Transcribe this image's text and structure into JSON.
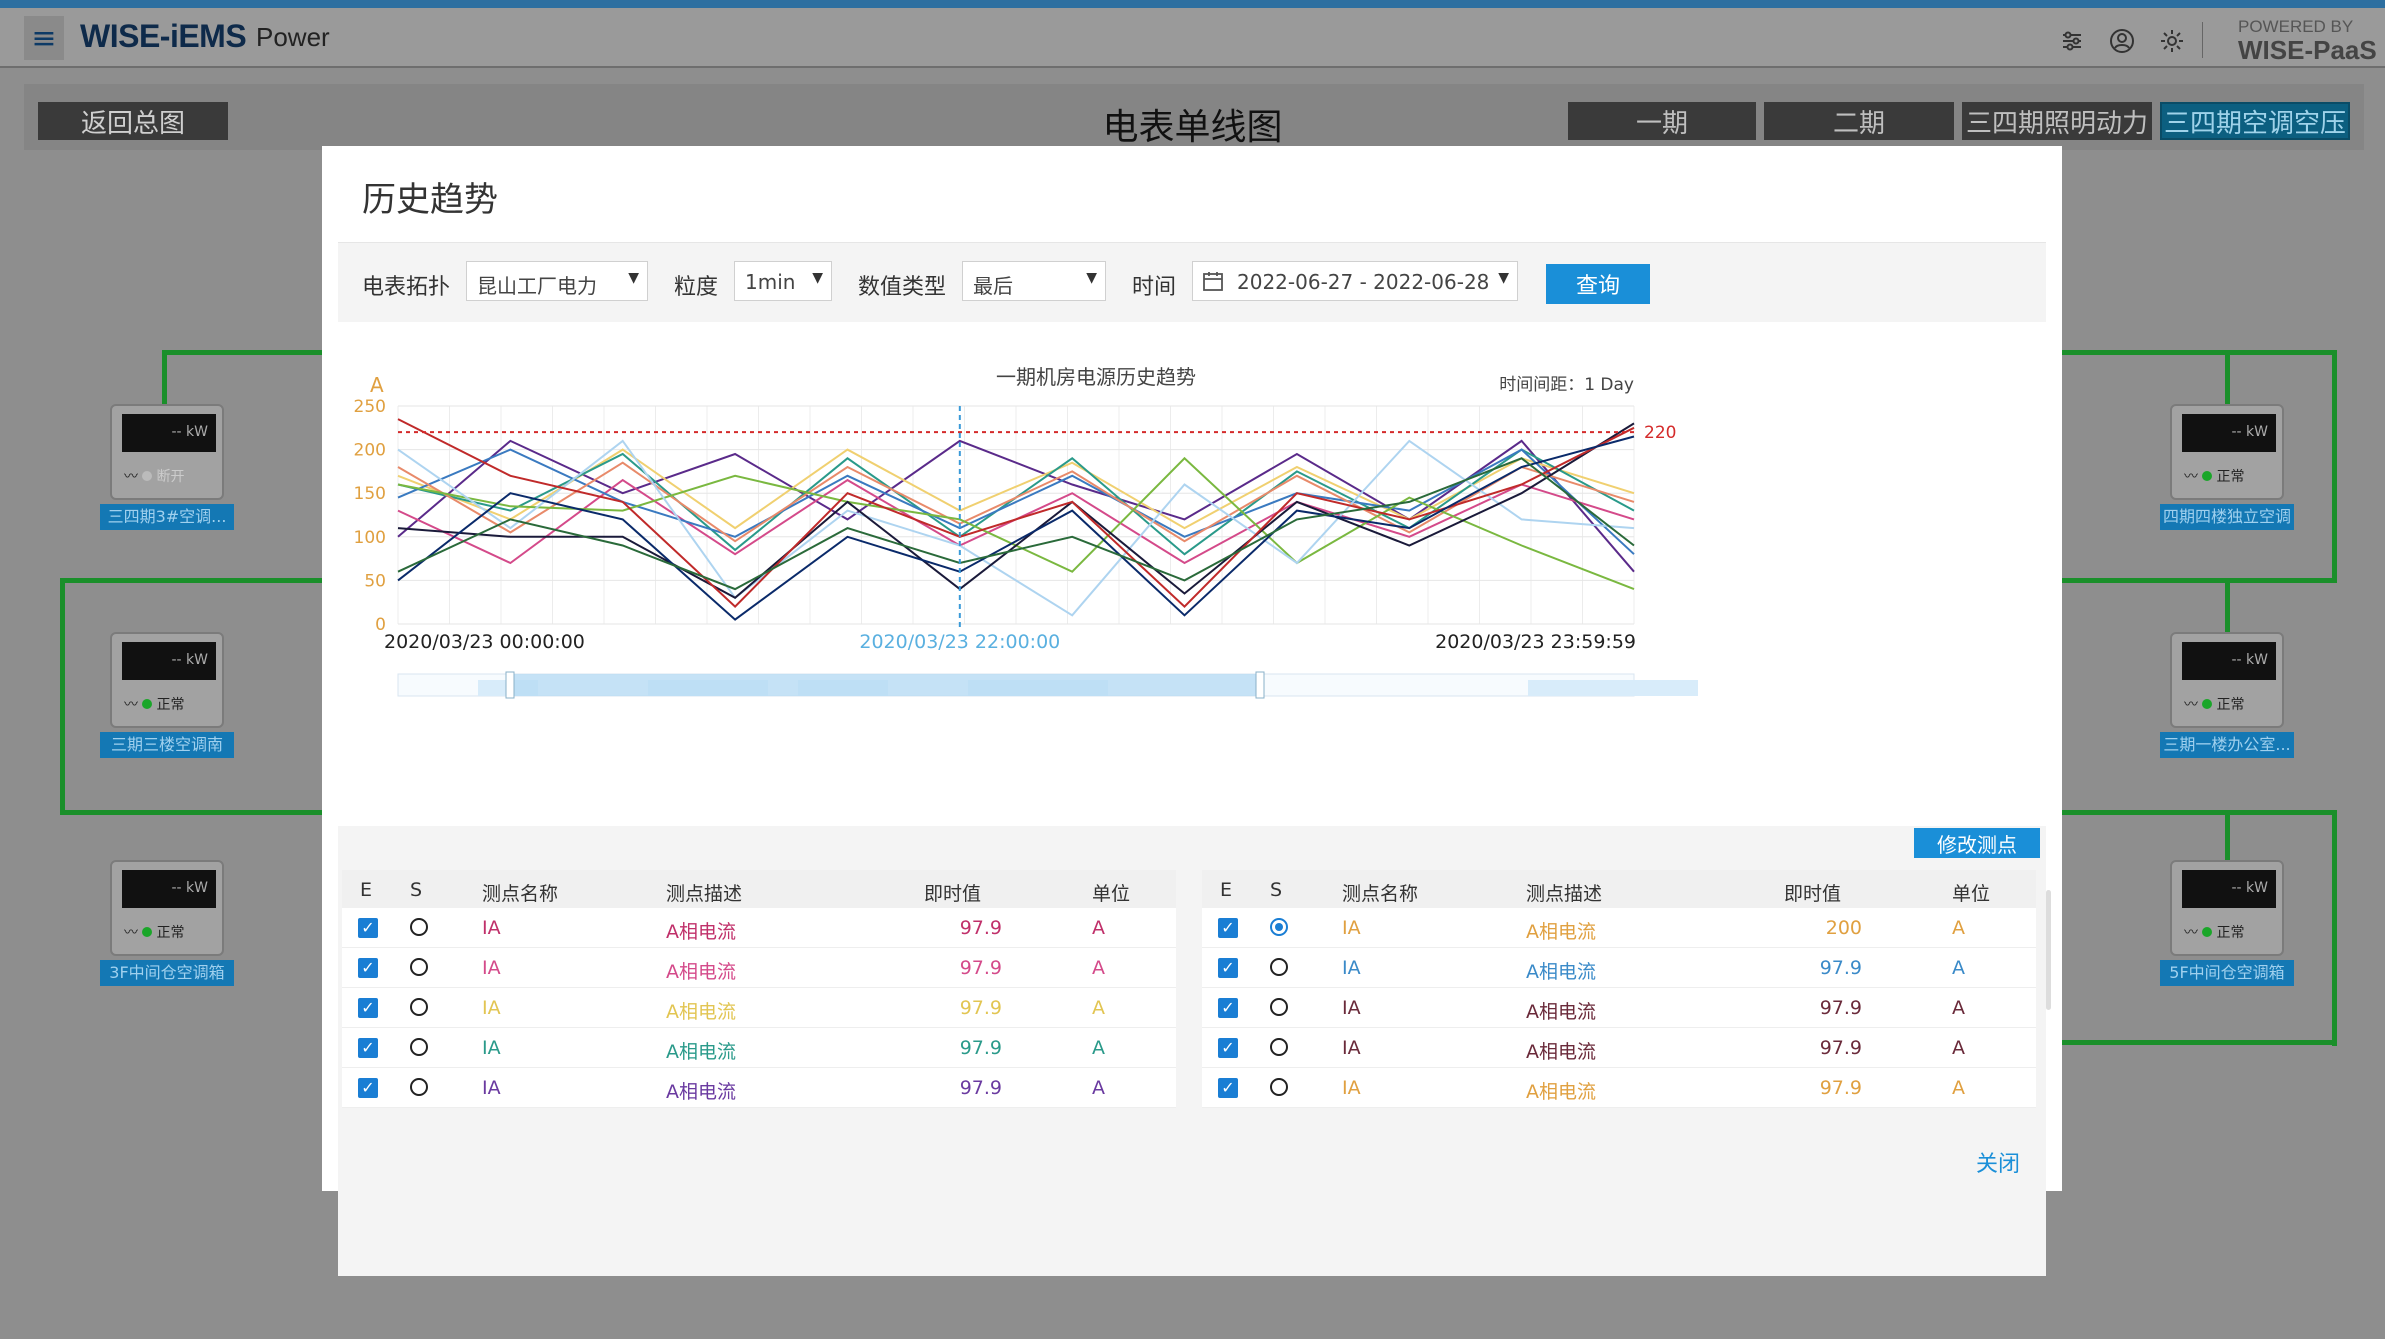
{
  "app": {
    "logo": "WISE-iEMS",
    "product": "Power",
    "powered_line1": "POWERED BY",
    "powered_line2": "WISE-PaaS",
    "menu_icon": "hamburger-icon",
    "icons": [
      "sliders-icon",
      "user-icon",
      "gear-icon"
    ]
  },
  "page": {
    "back_label": "返回总图",
    "title": "电表单线图",
    "phases": [
      "一期",
      "二期",
      "三四期照明动力",
      "三四期空调空压"
    ],
    "active_phase": 3
  },
  "meters_left": [
    {
      "value": "-- kW",
      "status": "断开",
      "label": "三四期3#空调..."
    },
    {
      "value": "-- kW",
      "status": "正常",
      "label": "三期三楼空调南"
    },
    {
      "value": "-- kW",
      "status": "正常",
      "label": "3F中间仓空调箱"
    }
  ],
  "meters_right": [
    {
      "value": "-- kW",
      "status": "正常",
      "label": "四期四楼独立空调"
    },
    {
      "value": "-- kW",
      "status": "正常",
      "label": "三期一楼办公室..."
    },
    {
      "value": "-- kW",
      "status": "正常",
      "label": "5F中间仓空调箱"
    }
  ],
  "modal": {
    "title": "历史趋势",
    "topology_label": "电表拓扑",
    "topology_value": "昆山工厂电力",
    "granularity_label": "粒度",
    "granularity_value": "1min",
    "value_type_label": "数值类型",
    "value_type_value": "最后",
    "time_label": "时间",
    "time_value": "2022-06-27 - 2022-06-28",
    "query_label": "查询",
    "edit_points_label": "修改测点",
    "close_label": "关闭"
  },
  "chart_data": {
    "type": "line",
    "title": "一期机房电源历史趋势",
    "interval_text": "时间间距：1 Day",
    "ylabel": "A",
    "ylim": [
      0,
      250
    ],
    "yticks": [
      0,
      50,
      100,
      150,
      200,
      250
    ],
    "x_labels": [
      "2020/03/23 00:00:00",
      "2020/03/23 22:00:00",
      "2020/03/23 23:59:59"
    ],
    "threshold": 220,
    "threshold_color": "#d42a2a",
    "x": [
      0,
      1,
      2,
      3,
      4,
      5,
      6,
      7,
      8,
      9,
      10,
      11
    ],
    "series": [
      {
        "color": "#5a2a8a",
        "values": [
          100,
          210,
          150,
          195,
          120,
          210,
          160,
          120,
          195,
          120,
          210,
          60
        ]
      },
      {
        "color": "#d44a8a",
        "values": [
          130,
          70,
          165,
          80,
          165,
          90,
          150,
          70,
          140,
          100,
          160,
          120
        ]
      },
      {
        "color": "#f0d070",
        "values": [
          170,
          120,
          200,
          110,
          200,
          130,
          185,
          110,
          180,
          120,
          190,
          150
        ]
      },
      {
        "color": "#2a9a8a",
        "values": [
          160,
          130,
          195,
          85,
          190,
          100,
          190,
          80,
          175,
          110,
          200,
          130
        ]
      },
      {
        "color": "#3a7ac0",
        "values": [
          145,
          200,
          140,
          100,
          170,
          110,
          170,
          100,
          150,
          130,
          200,
          80
        ]
      },
      {
        "color": "#e88a6a",
        "values": [
          180,
          105,
          185,
          95,
          180,
          115,
          175,
          95,
          170,
          105,
          180,
          140
        ]
      },
      {
        "color": "#7ab840",
        "values": [
          160,
          135,
          130,
          170,
          140,
          120,
          60,
          190,
          70,
          145,
          90,
          40
        ]
      },
      {
        "color": "#aed4f0",
        "values": [
          200,
          110,
          210,
          30,
          130,
          90,
          10,
          160,
          70,
          210,
          120,
          110
        ]
      },
      {
        "color": "#1a1a3a",
        "values": [
          110,
          100,
          100,
          30,
          140,
          40,
          140,
          35,
          140,
          90,
          150,
          230
        ]
      },
      {
        "color": "#c02a2a",
        "values": [
          235,
          170,
          140,
          20,
          150,
          100,
          140,
          20,
          150,
          120,
          160,
          225
        ]
      },
      {
        "color": "#0a2a6a",
        "values": [
          50,
          150,
          120,
          5,
          100,
          60,
          130,
          10,
          130,
          110,
          180,
          215
        ]
      },
      {
        "color": "#2a6a3a",
        "values": [
          60,
          120,
          90,
          40,
          110,
          70,
          100,
          50,
          120,
          140,
          190,
          90
        ]
      }
    ],
    "cursor_x": 5,
    "grid": true
  },
  "table_headers": {
    "e": "E",
    "s": "S",
    "name": "测点名称",
    "desc": "测点描述",
    "value": "即时值",
    "unit": "单位"
  },
  "table_left": [
    {
      "name": "IA",
      "desc": "A相电流",
      "value": "97.9",
      "unit": "A",
      "color": "#c0306a",
      "selected": false
    },
    {
      "name": "IA",
      "desc": "A相电流",
      "value": "97.9",
      "unit": "A",
      "color": "#d44a8a",
      "selected": false
    },
    {
      "name": "IA",
      "desc": "A相电流",
      "value": "97.9",
      "unit": "A",
      "color": "#e2c552",
      "selected": false
    },
    {
      "name": "IA",
      "desc": "A相电流",
      "value": "97.9",
      "unit": "A",
      "color": "#2a9a8a",
      "selected": false
    },
    {
      "name": "IA",
      "desc": "A相电流",
      "value": "97.9",
      "unit": "A",
      "color": "#6a3aa0",
      "selected": false
    }
  ],
  "table_right": [
    {
      "name": "IA",
      "desc": "A相电流",
      "value": "200",
      "unit": "A",
      "color": "#e0a040",
      "selected": true
    },
    {
      "name": "IA",
      "desc": "A相电流",
      "value": "97.9",
      "unit": "A",
      "color": "#3a8ac8",
      "selected": false
    },
    {
      "name": "IA",
      "desc": "A相电流",
      "value": "97.9",
      "unit": "A",
      "color": "#6a2a3a",
      "selected": false
    },
    {
      "name": "IA",
      "desc": "A相电流",
      "value": "97.9",
      "unit": "A",
      "color": "#6a2a3a",
      "selected": false
    },
    {
      "name": "IA",
      "desc": "A相电流",
      "value": "97.9",
      "unit": "A",
      "color": "#e0a040",
      "selected": false
    }
  ]
}
